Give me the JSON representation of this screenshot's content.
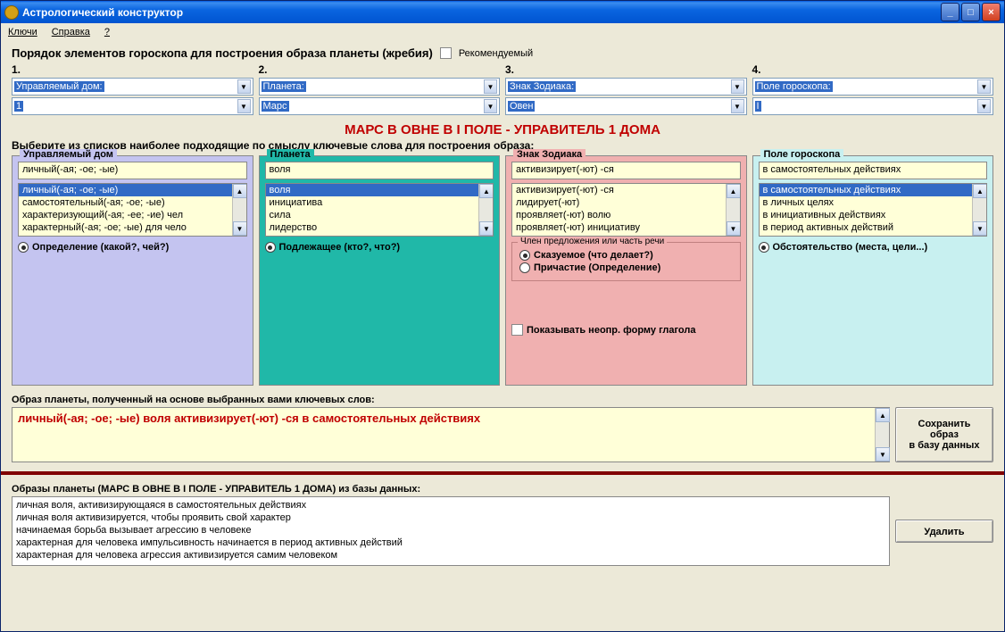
{
  "window": {
    "title": "Астрологический конструктор"
  },
  "menu": {
    "keys": "Ключи",
    "help": "Справка",
    "q": "?"
  },
  "order": {
    "label": "Порядок элементов гороскопа для построения образа планеты (жребия)",
    "recommended": "Рекомендуемый"
  },
  "cols": [
    {
      "num": "1.",
      "label": "Управляемый дом:",
      "value": "1"
    },
    {
      "num": "2.",
      "label": "Планета:",
      "value": "Марс"
    },
    {
      "num": "3.",
      "label": "Знак Зодиака:",
      "value": "Овен"
    },
    {
      "num": "4.",
      "label": "Поле гороскопа:",
      "value": "I"
    }
  ],
  "red_title": "МАРС В ОВНЕ В  I ПОЛЕ - УПРАВИТЕЛЬ 1 ДОМА",
  "choose": "Выберите из списков наиболее подходящие по смыслу ключевые слова для построения образа:",
  "panels": {
    "p1": {
      "title": "Управляемый дом",
      "field": "личный(-ая; -ое; -ые)",
      "items": [
        "личный(-ая; -ое; -ые)",
        "самостоятельный(-ая; -ое; -ые)",
        "характеризующий(-ая; -ее; -ие) чел",
        "характерный(-ая; -ое; -ые) для чело"
      ],
      "radio": "Определение (какой?, чей?)"
    },
    "p2": {
      "title": "Планета",
      "field": "воля",
      "items": [
        "воля",
        "инициатива",
        "сила",
        "лидерство"
      ],
      "radio": "Подлежащее (кто?, что?)"
    },
    "p3": {
      "title": "Знак Зодиака",
      "field": "активизирует(-ют) -ся",
      "items": [
        "активизирует(-ют) -ся",
        "лидирует(-ют)",
        "проявляет(-ют) волю",
        "проявляет(-ют) инициативу"
      ],
      "fs_title": "Член предложения или часть речи",
      "r1": "Сказуемое (что делает?)",
      "r2": "Причастие (Определение)",
      "check": "Показывать неопр. форму глагола"
    },
    "p4": {
      "title": "Поле гороскопа",
      "field": "в самостоятельных действиях",
      "items": [
        "в самостоятельных действиях",
        "в личных целях",
        "в инициативных действиях",
        "в период активных действий"
      ],
      "radio": "Обстоятельство (места, цели...)"
    }
  },
  "result": {
    "label": "Образ планеты, полученный на основе выбранных вами ключевых слов:",
    "text": "личный(-ая; -ое; -ые) воля активизирует(-ют) -ся в самостоятельных действиях",
    "save_btn_l1": "Сохранить образ",
    "save_btn_l2": "в базу данных"
  },
  "db": {
    "label": "Образы планеты (МАРС В ОВНЕ В  I ПОЛЕ - УПРАВИТЕЛЬ 1 ДОМА) из базы данных:",
    "items": [
      "личная воля, активизирующаяся в самостоятельных действиях",
      "личная воля активизируется, чтобы проявить свой характер",
      "начинаемая борьба вызывает агрессию в человеке",
      "характерная для человека импульсивность начинается в период активных действий",
      "характерная для человека агрессия активизируется самим человеком"
    ],
    "delete_btn": "Удалить"
  }
}
